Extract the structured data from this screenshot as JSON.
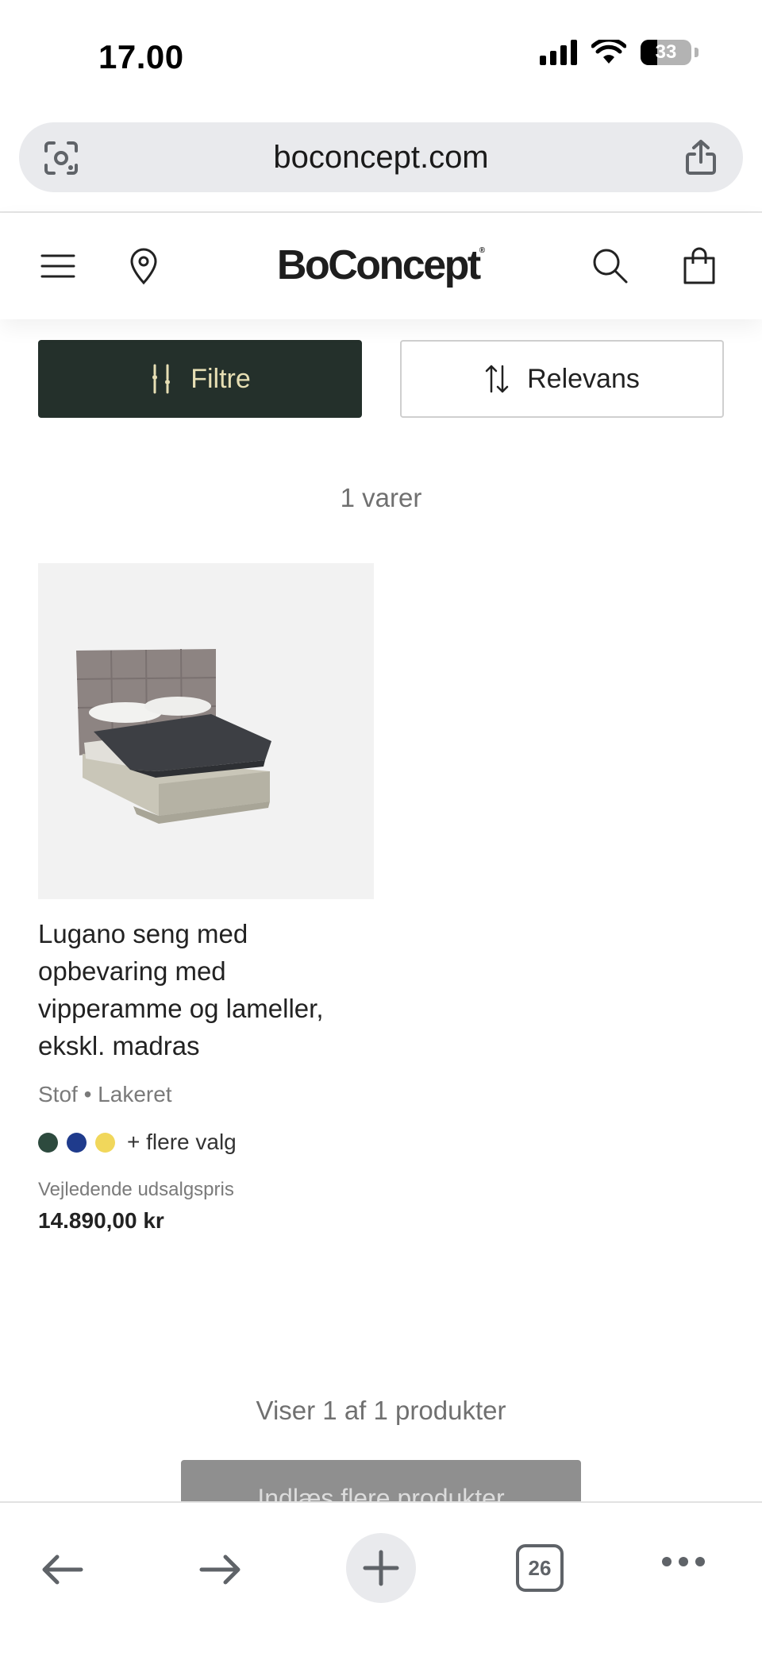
{
  "status_bar": {
    "time": "17.00",
    "battery": "33"
  },
  "browser": {
    "url": "boconcept.com",
    "tabs_count": "26"
  },
  "site": {
    "logo": "BoConcept"
  },
  "controls": {
    "filter_label": "Filtre",
    "sort_label": "Relevans"
  },
  "results": {
    "count_text": "1 varer",
    "showing_text": "Viser 1 af 1 produkter",
    "load_more_label": "Indlæs flere produkter"
  },
  "product": {
    "title": "Lugano seng med opbevaring med vipperamme og lameller, ekskl. madras",
    "materials": "Stof • Lakeret",
    "swatches": [
      {
        "name": "dark-green",
        "color": "#2d4a3e"
      },
      {
        "name": "navy-blue",
        "color": "#1f3b8c"
      },
      {
        "name": "yellow",
        "color": "#f1d75b"
      }
    ],
    "more_options": "+ flere valg",
    "price_label": "Vejledende udsalgspris",
    "price": "14.890,00 kr"
  },
  "colors": {
    "filter_bg": "#24302b",
    "filter_text": "#e7dfb4",
    "url_bar_bg": "#e9eaed",
    "muted_text": "#707070"
  }
}
